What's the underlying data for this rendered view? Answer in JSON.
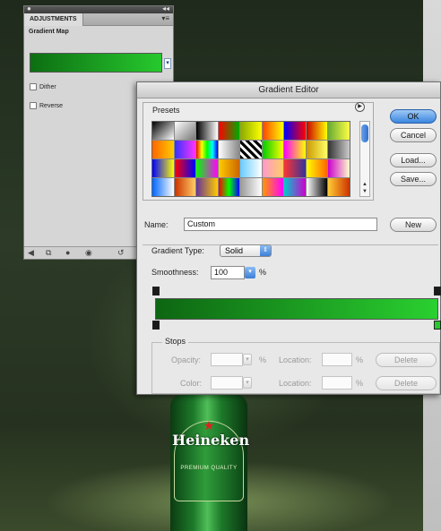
{
  "adjustments_panel": {
    "tab_label": "ADJUSTMENTS",
    "title": "Gradient Map",
    "dither_label": "Dither",
    "reverse_label": "Reverse"
  },
  "gradient_editor": {
    "title": "Gradient Editor",
    "presets_label": "Presets",
    "ok_label": "OK",
    "cancel_label": "Cancel",
    "load_label": "Load...",
    "save_label": "Save...",
    "name_label": "Name:",
    "name_value": "Custom",
    "new_label": "New",
    "gradient_type_label": "Gradient Type:",
    "gradient_type_value": "Solid",
    "smoothness_label": "Smoothness:",
    "smoothness_value": "100",
    "smoothness_unit": "%",
    "stops_label": "Stops",
    "opacity_label": "Opacity:",
    "opacity_unit": "%",
    "location_label": "Location:",
    "location_unit": "%",
    "color_label": "Color:",
    "delete_label": "Delete",
    "gradient_start_color": "#0d6612",
    "gradient_end_color": "#2ad030"
  },
  "preset_swatches": [
    "linear-gradient(135deg,#000,#fff)",
    "linear-gradient(135deg,#fff,#777)",
    "linear-gradient(90deg,#000,#fff)",
    "linear-gradient(90deg,#ff0000,#00aa00)",
    "linear-gradient(90deg,#8a0,#ff0)",
    "linear-gradient(90deg,#f40,#ff0)",
    "linear-gradient(90deg,#00f,#f00)",
    "linear-gradient(90deg,#c00,#ff0)",
    "linear-gradient(90deg,#6a3,#ff4)",
    "linear-gradient(90deg,#f60,#fc0)",
    "linear-gradient(90deg,#33f,#f3f)",
    "linear-gradient(90deg,#f00,#ff0,#0f0,#0ff,#00f)",
    "linear-gradient(90deg,#fff,#888)",
    "repeating-linear-gradient(45deg,#000 0 3px,#fff 3px 6px)",
    "linear-gradient(90deg,#0c0,#ff0)",
    "linear-gradient(90deg,#f0f,#ff0)",
    "linear-gradient(90deg,#c90,#ff6)",
    "linear-gradient(90deg,#333,#ccc)",
    "linear-gradient(90deg,#00f,#ff0)",
    "linear-gradient(90deg,#f00,#00f)",
    "linear-gradient(90deg,#0f0,#f0f)",
    "linear-gradient(90deg,#fc0,#c60)",
    "linear-gradient(90deg,#6cf,#fff)",
    "linear-gradient(90deg,#f9c,#fc6)",
    "linear-gradient(90deg,#f33,#339)",
    "linear-gradient(90deg,#ff0,#f60)",
    "linear-gradient(90deg,#c0c,#ffc)",
    "linear-gradient(90deg,#06f,#fff)",
    "linear-gradient(90deg,#c30,#fc6)",
    "linear-gradient(90deg,#639,#fc0)",
    "linear-gradient(90deg,#f00,#0f0,#00f)",
    "linear-gradient(90deg,#999,#fff)",
    "linear-gradient(90deg,#f90,#f0f)",
    "linear-gradient(90deg,#0cc,#c0c)",
    "linear-gradient(90deg,#fff,#000)",
    "linear-gradient(90deg,#fc3,#c30)"
  ],
  "background": {
    "brand_text": "Heineken",
    "premium_text": "PREMIUM QUALITY"
  }
}
